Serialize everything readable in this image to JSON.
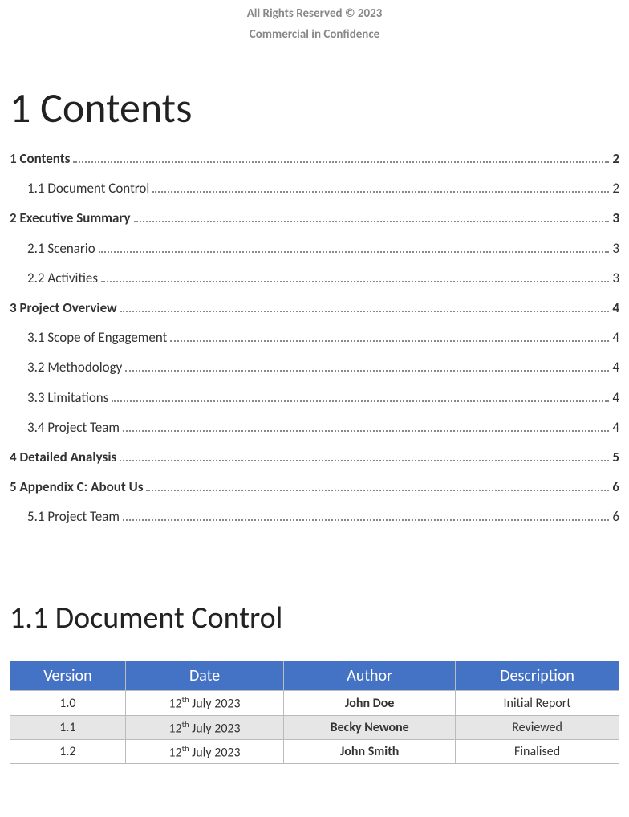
{
  "header": {
    "copyright": "All Rights Reserved © 2023",
    "confidence": "Commercial in Confidence"
  },
  "contents_heading": "1 Contents",
  "toc": [
    {
      "level": 1,
      "title": "1 Contents",
      "page": "2"
    },
    {
      "level": 2,
      "title": "1.1 Document Control",
      "page": "2"
    },
    {
      "level": 1,
      "title": "2 Executive Summary",
      "page": "3"
    },
    {
      "level": 2,
      "title": "2.1 Scenario",
      "page": "3"
    },
    {
      "level": 2,
      "title": "2.2 Activities",
      "page": "3"
    },
    {
      "level": 1,
      "title": "3 Project Overview",
      "page": "4"
    },
    {
      "level": 2,
      "title": "3.1 Scope of Engagement",
      "page": "4"
    },
    {
      "level": 2,
      "title": "3.2 Methodology",
      "page": "4"
    },
    {
      "level": 2,
      "title": "3.3 Limitations",
      "page": "4"
    },
    {
      "level": 2,
      "title": "3.4 Project Team",
      "page": "4"
    },
    {
      "level": 1,
      "title": "4 Detailed Analysis",
      "page": "5"
    },
    {
      "level": 1,
      "title": "5 Appendix C: About Us",
      "page": "6"
    },
    {
      "level": 2,
      "title": "5.1 Project Team",
      "page": "6"
    }
  ],
  "doc_control_heading": "1.1 Document Control",
  "doc_control": {
    "headers": {
      "version": "Version",
      "date": "Date",
      "author": "Author",
      "description": "Description"
    },
    "rows": [
      {
        "version": "1.0",
        "date_day": "12",
        "date_suffix": "th",
        "date_rest": " July 2023",
        "author": "John Doe",
        "description": "Initial Report",
        "alt": false
      },
      {
        "version": "1.1",
        "date_day": "12",
        "date_suffix": "th",
        "date_rest": " July 2023",
        "author": "Becky Newone",
        "description": "Reviewed",
        "alt": true
      },
      {
        "version": "1.2",
        "date_day": "12",
        "date_suffix": "th",
        "date_rest": " July 2023",
        "author": "John Smith",
        "description": "Finalised",
        "alt": false
      }
    ]
  }
}
